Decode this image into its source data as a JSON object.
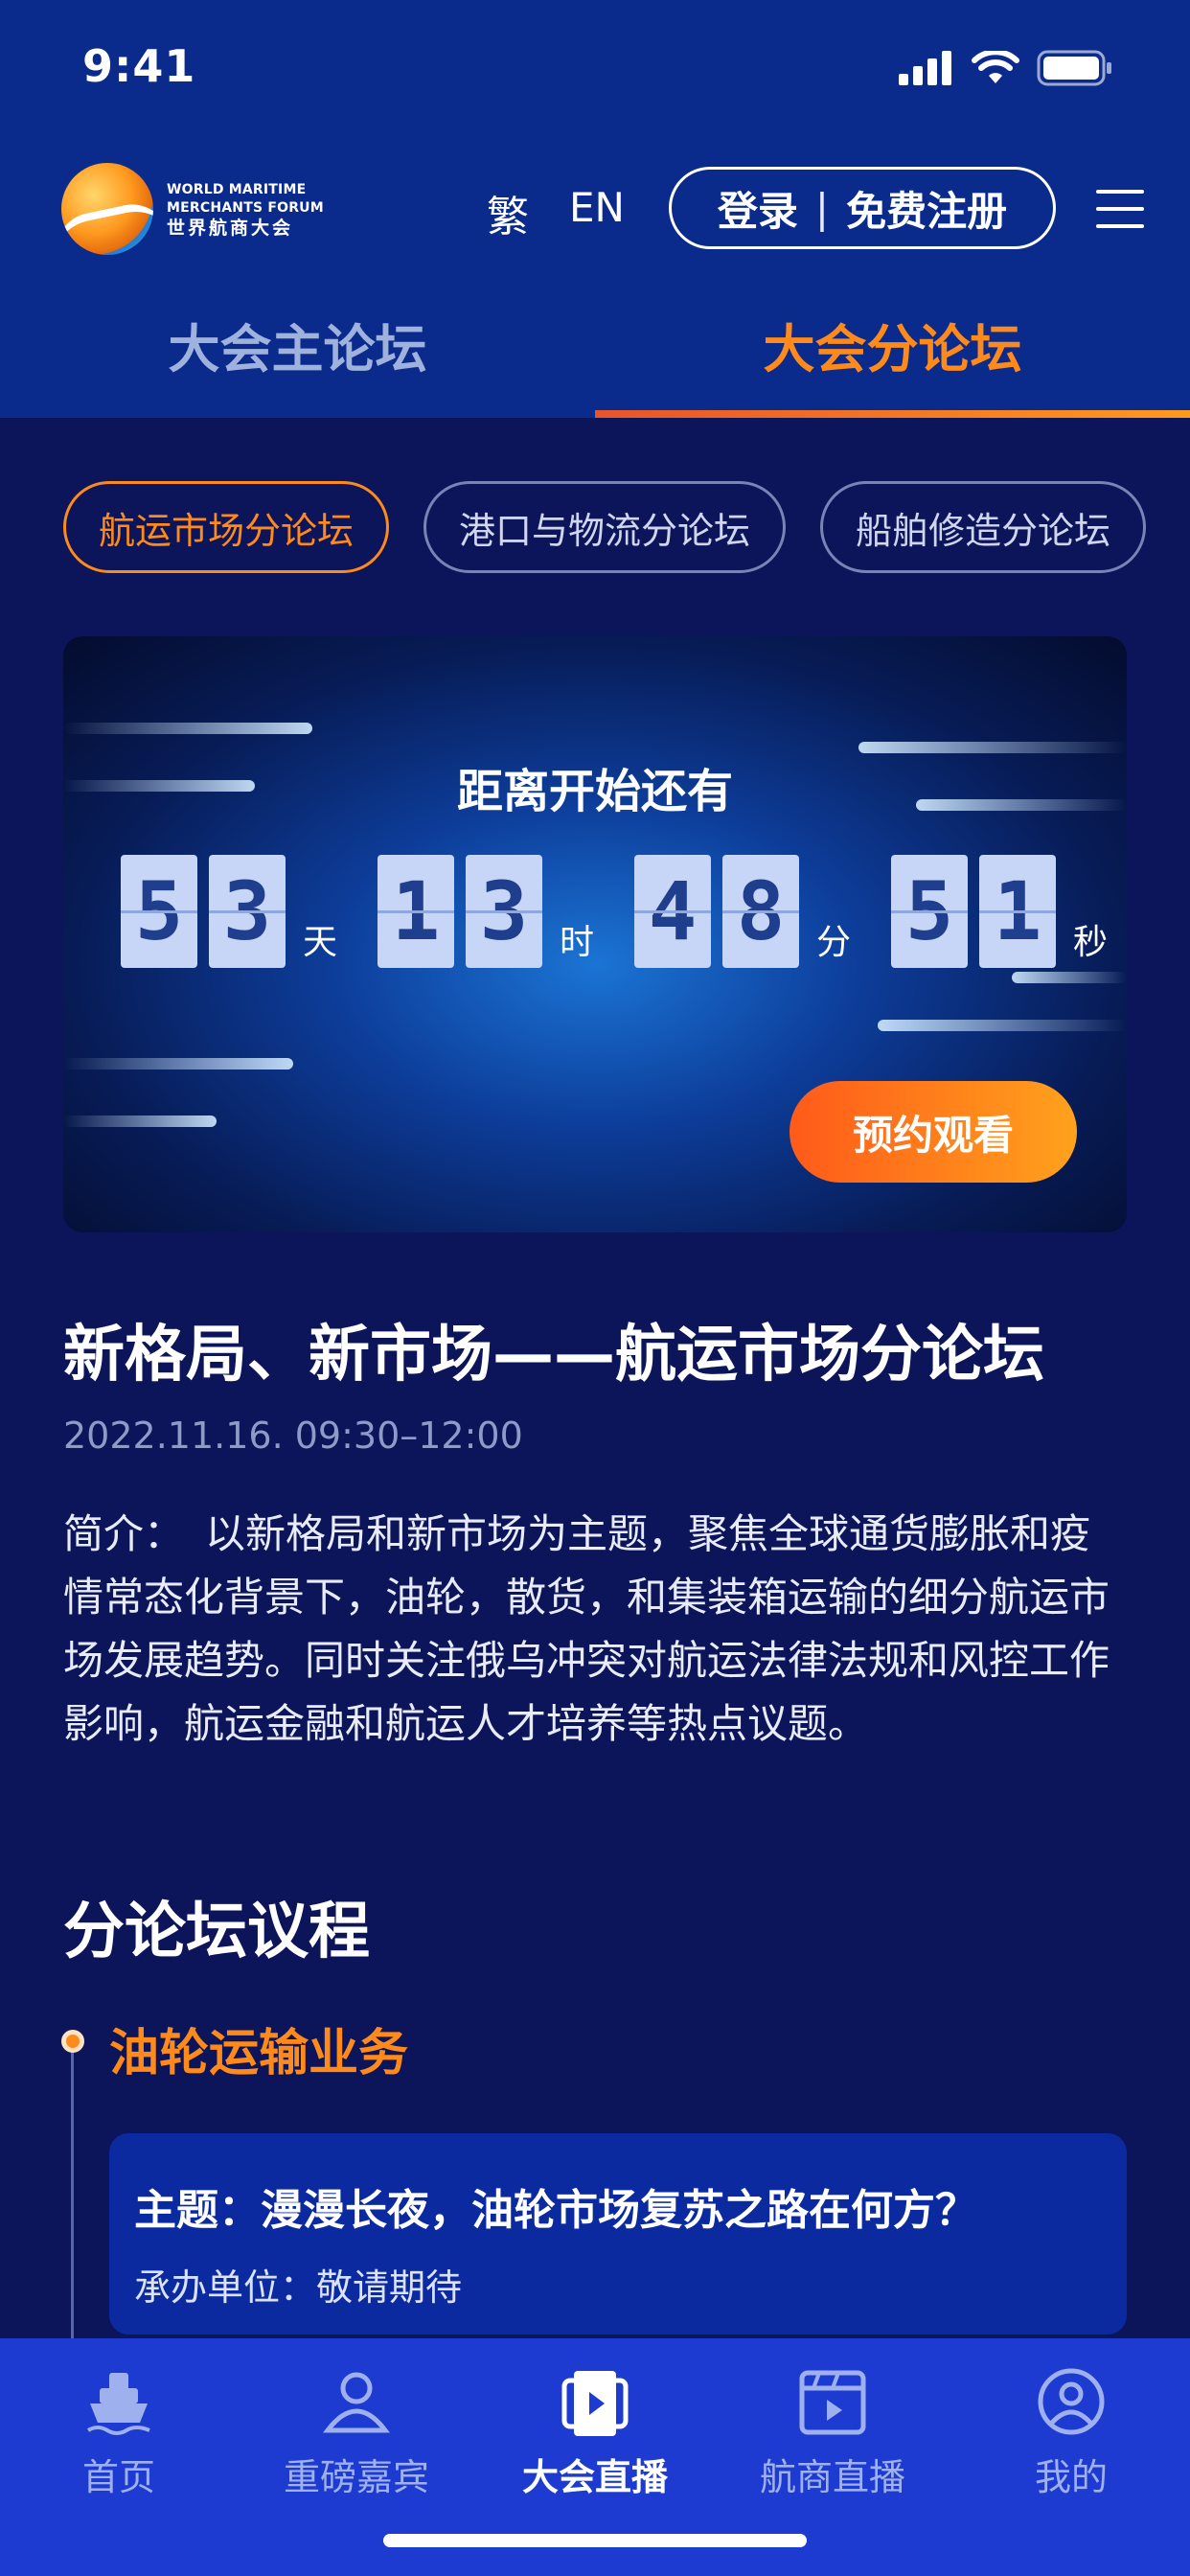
{
  "status_bar": {
    "time": "9:41"
  },
  "header": {
    "logo_en_line1": "WORLD MARITIME",
    "logo_en_line2": "MERCHANTS FORUM",
    "logo_cn": "世界航商大会",
    "lang_traditional": "繁",
    "lang_english": "EN",
    "login_label": "登录",
    "login_separator": "|",
    "register_label": "免费注册"
  },
  "main_tabs": [
    {
      "label": "大会主论坛",
      "active": false
    },
    {
      "label": "大会分论坛",
      "active": true
    }
  ],
  "sub_tabs": [
    {
      "label": "航运市场分论坛",
      "active": true
    },
    {
      "label": "港口与物流分论坛",
      "active": false
    },
    {
      "label": "船舶修造分论坛",
      "active": false
    }
  ],
  "countdown": {
    "title": "距离开始还有",
    "days": [
      "5",
      "3"
    ],
    "days_unit": "天",
    "hours": [
      "1",
      "3"
    ],
    "hours_unit": "时",
    "minutes": [
      "4",
      "8"
    ],
    "minutes_unit": "分",
    "seconds": [
      "5",
      "1"
    ],
    "seconds_unit": "秒",
    "reserve_label": "预约观看"
  },
  "forum": {
    "title": "新格局、新市场——航运市场分论坛",
    "datetime": "2022.11.16. 09:30–12:00",
    "intro_label": "简介：",
    "intro_text": "以新格局和新市场为主题，聚焦全球通货膨胀和疫情常态化背景下，油轮，散货，和集装箱运输的细分航运市场发展趋势。同时关注俄乌冲突对航运法律法规和风控工作影响，航运金融和航运人才培养等热点议题。"
  },
  "agenda": {
    "title": "分论坛议程",
    "items": [
      {
        "title": "油轮运输业务",
        "topic": "主题：漫漫长夜，油轮市场复苏之路在何方？",
        "host": "承办单位：敬请期待"
      }
    ]
  },
  "bottom_nav": [
    {
      "label": "首页",
      "icon": "ship-icon",
      "active": false
    },
    {
      "label": "重磅嘉宾",
      "icon": "person-icon",
      "active": false
    },
    {
      "label": "大会直播",
      "icon": "live-video-icon",
      "active": true
    },
    {
      "label": "航商直播",
      "icon": "clapper-icon",
      "active": false
    },
    {
      "label": "我的",
      "icon": "user-circle-icon",
      "active": false
    }
  ],
  "colors": {
    "accent": "#ff8a1c",
    "header_bg": "#0a2a8c",
    "page_bg": "#0c1559",
    "nav_bg": "#1d3bd0"
  }
}
